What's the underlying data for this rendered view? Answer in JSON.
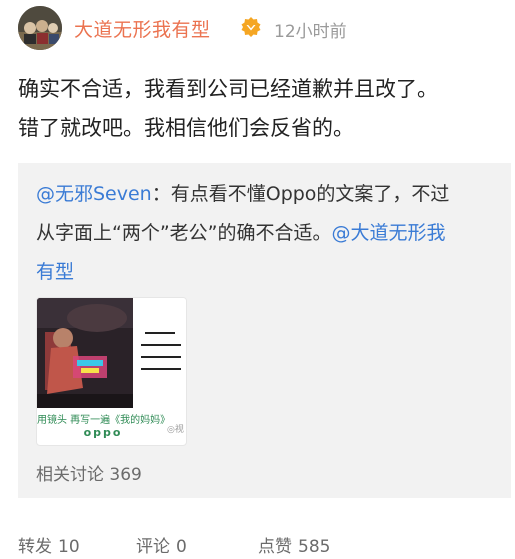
{
  "post": {
    "author": "大道无形我有型",
    "verified_badge": "gold-v-badge",
    "time": "12小时前",
    "body_lines": [
      "确实不合适，我看到公司已经道歉并且改了。",
      "错了就改吧。我相信他们会反省的。"
    ]
  },
  "repost": {
    "line1_mention": "@无邪Seven",
    "line1_text": "：有点看不懂Oppo的文案了，不过",
    "line2_text": "从字面上“两个”老公”的确不合适。",
    "line2_mention": "@大道无形我",
    "line3_mention": "有型",
    "card": {
      "caption": "用镜头 再写一遍《我的妈妈》",
      "brand": "oppo",
      "play_label": "◎视"
    },
    "related_label": "相关讨论",
    "related_count": "369"
  },
  "actions": {
    "repost_label": "转发",
    "repost_count": "10",
    "comment_label": "评论",
    "comment_count": "0",
    "like_label": "点赞",
    "like_count": "585"
  },
  "colors": {
    "username": "#eb7350",
    "mention": "#3a7bd5",
    "badge": "#f5a623"
  }
}
